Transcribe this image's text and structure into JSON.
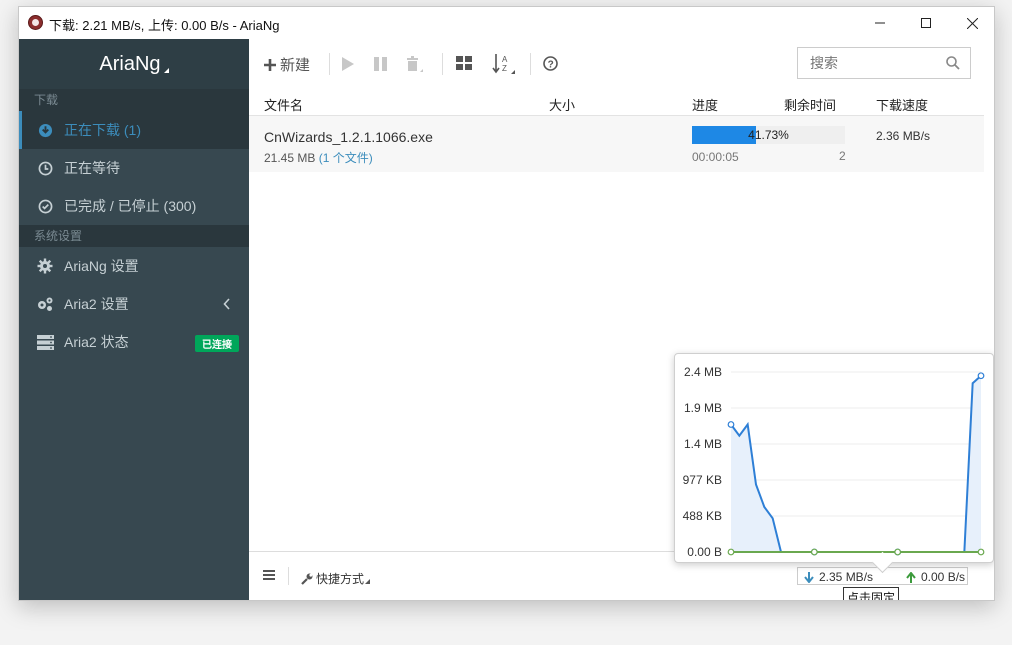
{
  "window": {
    "title": "下载: 2.21 MB/s, 上传: 0.00 B/s - AriaNg"
  },
  "sidebar": {
    "brand": "AriaNg",
    "download_section": "下载",
    "settings_section": "系统设置",
    "items": [
      {
        "label": "正在下载 (1)",
        "icon": "download-circle-icon"
      },
      {
        "label": "正在等待",
        "icon": "clock-icon"
      },
      {
        "label": "已完成 / 已停止 (300)",
        "icon": "check-circle-icon"
      },
      {
        "label": "AriaNg 设置",
        "icon": "gear-icon"
      },
      {
        "label": "Aria2 设置",
        "icon": "gears-icon"
      },
      {
        "label": "Aria2 状态",
        "icon": "server-icon",
        "badge": "已连接"
      }
    ]
  },
  "toolbar": {
    "new_label": "新建",
    "search_placeholder": "搜索"
  },
  "table": {
    "headers": {
      "name": "文件名",
      "size": "大小",
      "progress": "进度",
      "remaining": "剩余时间",
      "speed": "下载速度"
    },
    "rows": [
      {
        "name": "CnWizards_1.2.1.1066.exe",
        "size": "21.45 MB",
        "files": "(1 个文件)",
        "progress_text": "41.73%",
        "progress": 41.73,
        "elapsed": "00:00:05",
        "connections": "2",
        "speed": "2.36 MB/s"
      }
    ]
  },
  "footer": {
    "shortcut_label": "快捷方式",
    "download_speed": "2.35 MB/s",
    "upload_speed": "0.00 B/s",
    "tooltip": "点击固定"
  },
  "chart_data": {
    "type": "area",
    "y_ticks": [
      "2.4 MB",
      "1.9 MB",
      "1.4 MB",
      "977 KB",
      "488 KB",
      "0.00 B"
    ],
    "ylim": [
      0,
      2.4
    ],
    "series": [
      {
        "values": [
          1.7,
          1.55,
          1.7,
          0.9,
          0.6,
          0.45,
          0,
          0,
          0,
          0,
          0,
          0,
          0,
          0,
          0,
          0,
          0,
          0,
          0,
          0,
          0,
          0,
          0,
          0,
          0,
          0,
          0,
          0,
          0,
          2.25,
          2.35
        ]
      },
      {
        "values": [
          0,
          0,
          0,
          0,
          0,
          0,
          0,
          0,
          0,
          0,
          0,
          0,
          0,
          0,
          0,
          0,
          0,
          0,
          0,
          0,
          0,
          0,
          0,
          0,
          0,
          0,
          0,
          0,
          0,
          0,
          0
        ]
      }
    ],
    "colors": {
      "download": "#2e7fd6",
      "upload": "#6aa84f"
    }
  },
  "colors": {
    "accent": "#3c8dbc",
    "sidebar_bg": "#374850",
    "progress": "#1e88e5",
    "badge": "#00a65a"
  }
}
